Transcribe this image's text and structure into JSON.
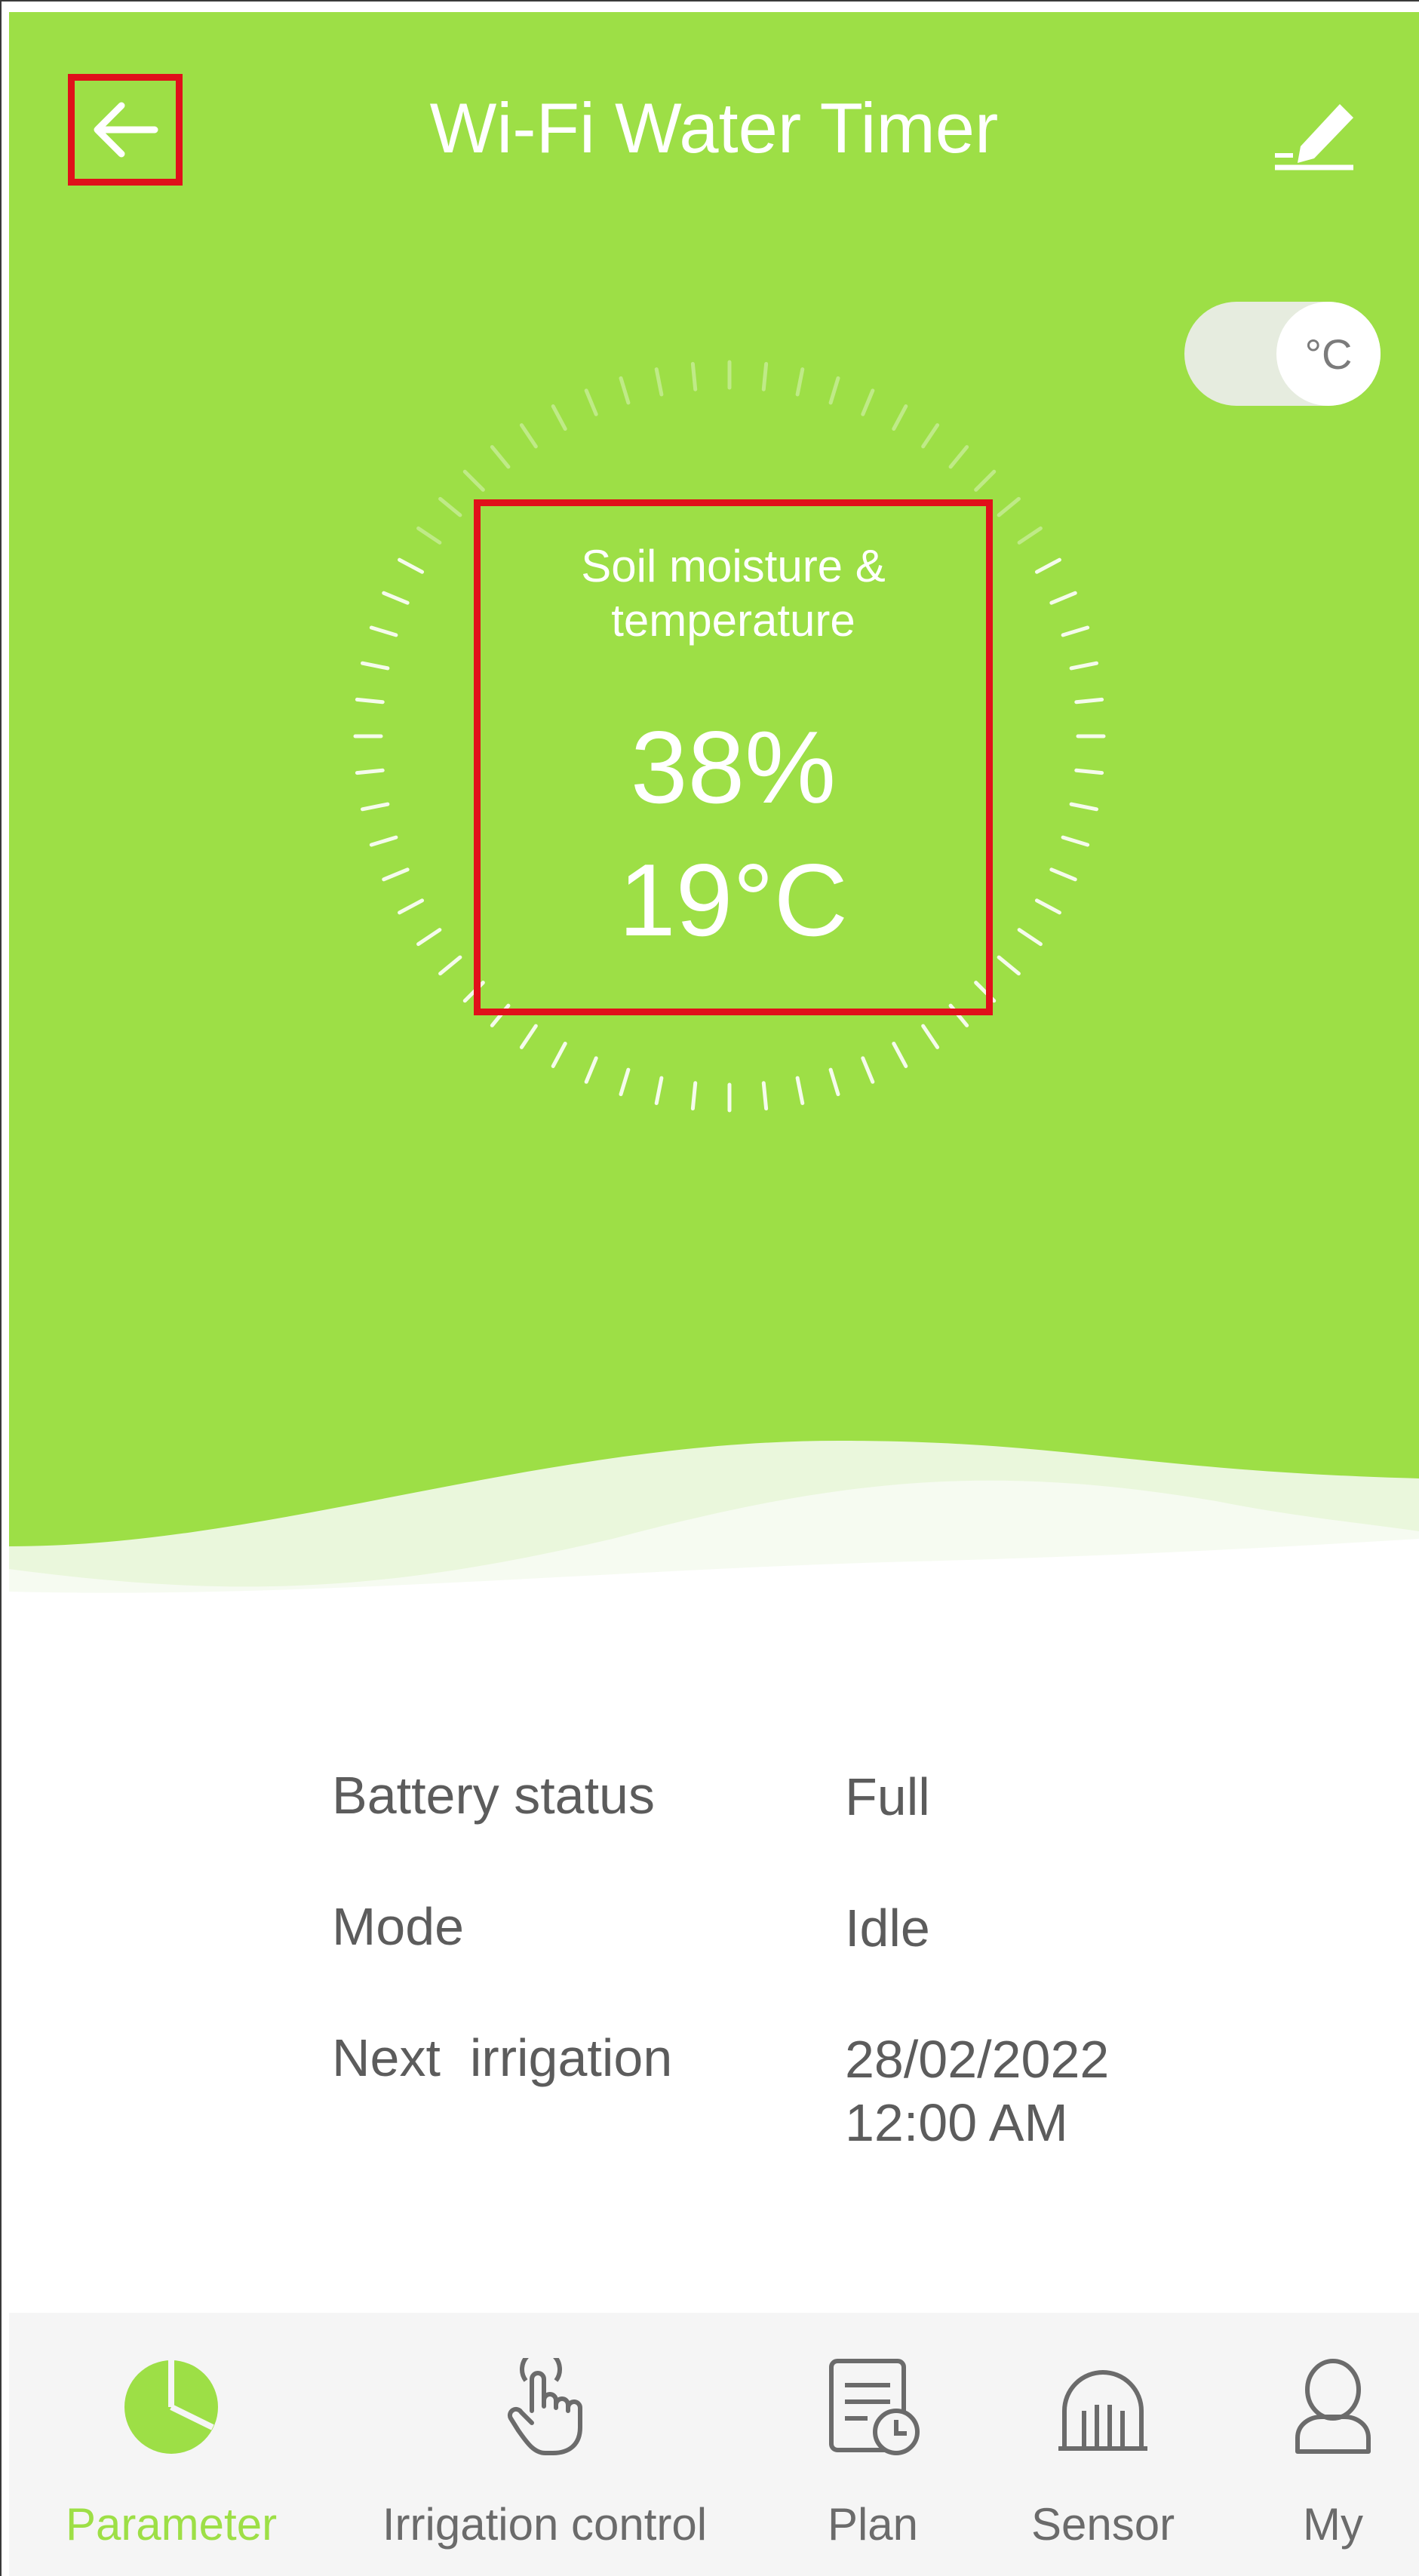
{
  "header": {
    "title": "Wi-Fi Water Timer",
    "back_icon": "arrow-left-icon",
    "edit_icon": "pencil-icon"
  },
  "unit_toggle": {
    "label": "°C",
    "selected": "°C"
  },
  "gauge": {
    "label_line1": "Soil moisture &",
    "label_line2": "temperature",
    "moisture": "38%",
    "temperature": "19°C"
  },
  "info": {
    "battery_label": "Battery status",
    "battery_value": "Full",
    "mode_label": "Mode",
    "mode_value": "Idle",
    "next_label": "Next  irrigation",
    "next_date": "28/02/2022",
    "next_time": "12:00 AM"
  },
  "nav": {
    "items": [
      {
        "label": "Parameter",
        "icon": "pie-chart-icon",
        "active": true
      },
      {
        "label": "Irrigation control",
        "icon": "hand-tap-icon",
        "active": false
      },
      {
        "label": "Plan",
        "icon": "schedule-document-icon",
        "active": false
      },
      {
        "label": "Sensor",
        "icon": "sensor-dome-icon",
        "active": false
      },
      {
        "label": "My",
        "icon": "user-icon",
        "active": false
      }
    ]
  },
  "colors": {
    "accent_green": "#9ddf46",
    "highlight_red": "#e0101a",
    "text_gray": "#5c5c5c"
  }
}
